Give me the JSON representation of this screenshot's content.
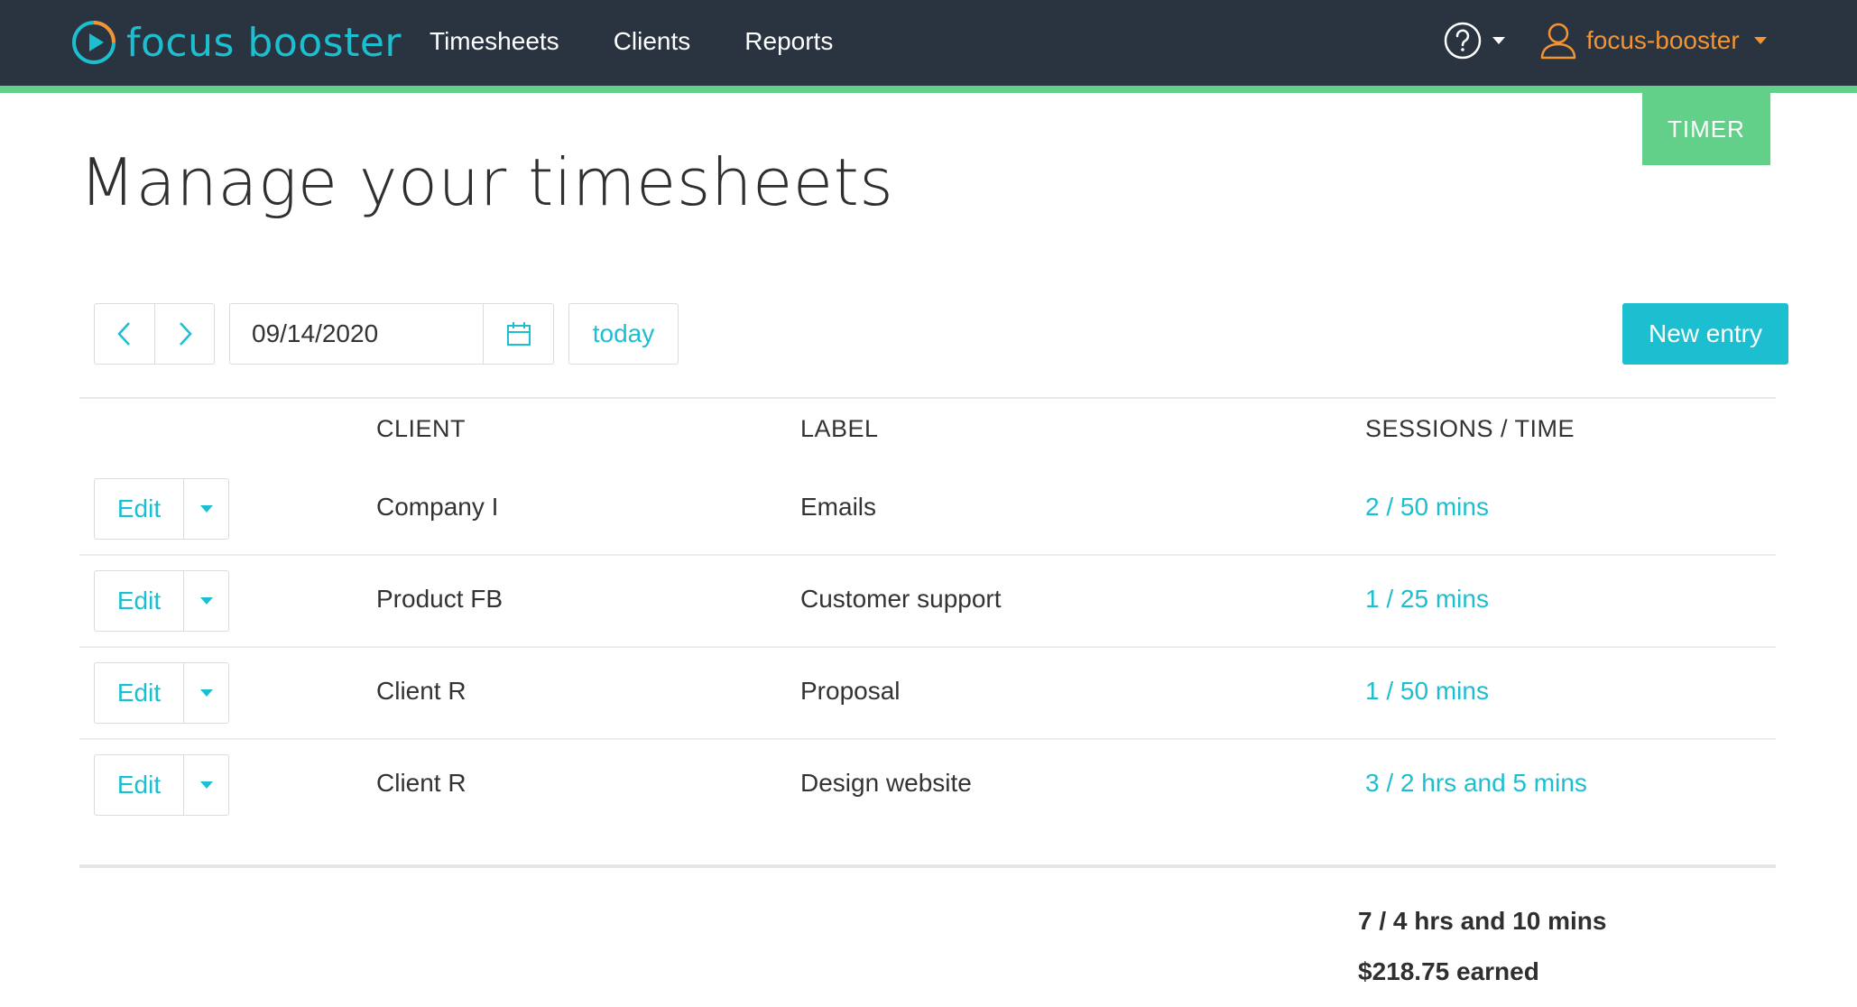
{
  "brand": {
    "name": "focus booster",
    "color": "#1bbfd0"
  },
  "nav": {
    "items": [
      "Timesheets",
      "Clients",
      "Reports"
    ]
  },
  "header": {
    "help_icon": "help-circle-icon",
    "user_icon": "user-icon",
    "user_name": "focus-booster",
    "user_color": "#f29433"
  },
  "timer": {
    "label": "TIMER",
    "color": "#63d08a"
  },
  "page": {
    "title": "Manage your timesheets"
  },
  "toolbar": {
    "date_value": "09/14/2020",
    "today_label": "today",
    "new_entry_label": "New entry"
  },
  "table": {
    "headers": {
      "client": "CLIENT",
      "label": "LABEL",
      "sessions": "SESSIONS / TIME"
    },
    "rows": [
      {
        "edit": "Edit",
        "client": "Company I",
        "label": "Emails",
        "sessions": "2 / 50 mins"
      },
      {
        "edit": "Edit",
        "client": "Product FB",
        "label": "Customer support",
        "sessions": "1 / 25 mins"
      },
      {
        "edit": "Edit",
        "client": "Client R",
        "label": "Proposal",
        "sessions": "1 / 50 mins"
      },
      {
        "edit": "Edit",
        "client": "Client R",
        "label": "Design website",
        "sessions": "3 / 2 hrs and 5 mins"
      }
    ]
  },
  "summary": {
    "total": "7 / 4 hrs and 10 mins",
    "earned": "$218.75 earned"
  }
}
